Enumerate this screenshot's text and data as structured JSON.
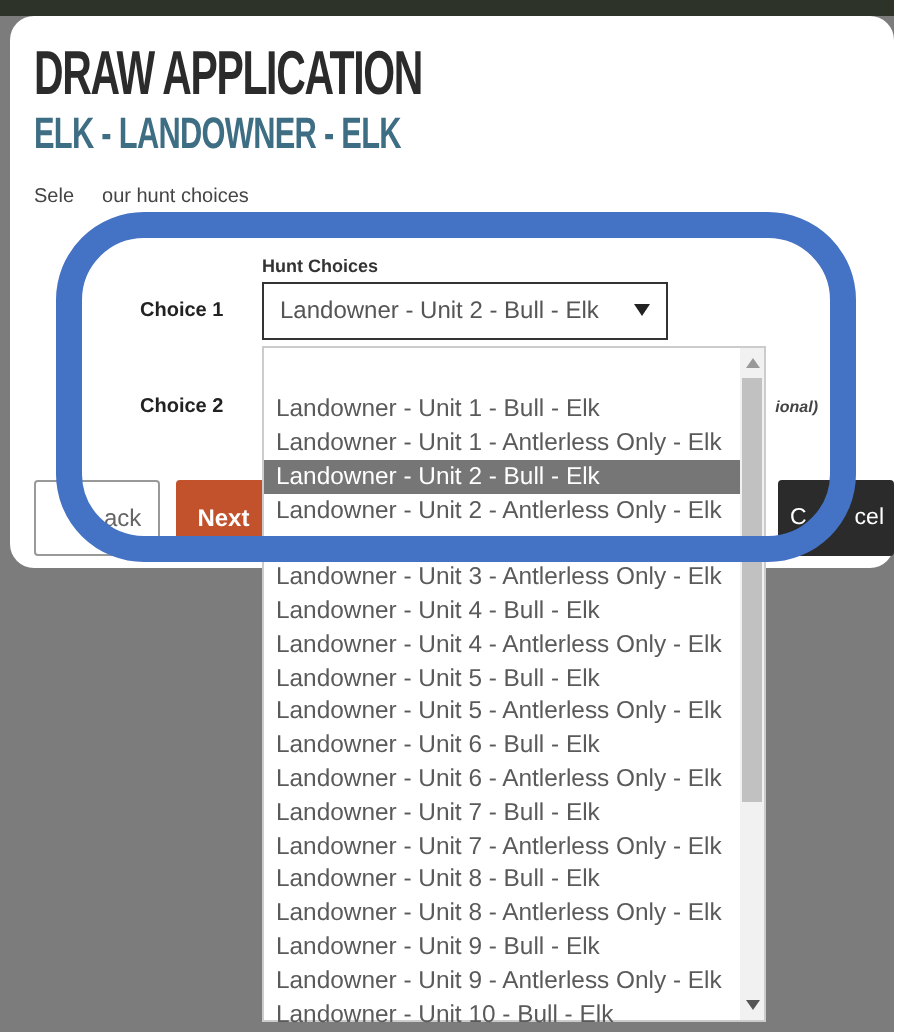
{
  "dialog": {
    "title": "DRAW APPLICATION",
    "subtitle": "ELK - LANDOWNER - ELK",
    "intro_parts": [
      "Sele",
      "our hunt choices"
    ],
    "field_label": "Hunt Choices",
    "choices": [
      {
        "label": "Choice 1",
        "value": "Landowner - Unit 2 - Bull - Elk"
      },
      {
        "label": "Choice 2",
        "note": "ional)"
      }
    ],
    "back_button": "ack",
    "next_button": "Next",
    "cancel_button_parts": [
      "C",
      "cel"
    ]
  },
  "dropdown": {
    "options": [
      {
        "kind": "blank"
      },
      {
        "kind": "option",
        "label": "Landowner - Unit 1 - Bull - Elk",
        "selected": false
      },
      {
        "kind": "option",
        "label": "Landowner - Unit 1 - Antlerless Only - Elk",
        "selected": false
      },
      {
        "kind": "option",
        "label": "Landowner - Unit 2 - Bull - Elk",
        "selected": true
      },
      {
        "kind": "option",
        "label": "Landowner - Unit 2 - Antlerless Only - Elk",
        "selected": false
      },
      {
        "kind": "blank"
      },
      {
        "kind": "option",
        "label": "Landowner - Unit 3 - Antlerless Only - Elk",
        "selected": false
      },
      {
        "kind": "option",
        "label": "Landowner - Unit 4 - Bull - Elk",
        "selected": false
      },
      {
        "kind": "option",
        "label": "Landowner - Unit 4 - Antlerless Only - Elk",
        "selected": false
      },
      {
        "kind": "option",
        "label": "Landowner - Unit 5 - Bull - Elk",
        "selected": false
      },
      {
        "kind": "option",
        "label": "Landowner - Unit 5 - Antlerless Only - Elk",
        "selected": false
      },
      {
        "kind": "option",
        "label": "Landowner - Unit 6 - Bull - Elk",
        "selected": false
      },
      {
        "kind": "option",
        "label": "Landowner - Unit 6 - Antlerless Only - Elk",
        "selected": false
      },
      {
        "kind": "option",
        "label": "Landowner - Unit 7 - Bull - Elk",
        "selected": false
      },
      {
        "kind": "option",
        "label": "Landowner - Unit 7 - Antlerless Only - Elk",
        "selected": false
      },
      {
        "kind": "option",
        "label": "Landowner - Unit 8 - Bull - Elk",
        "selected": false
      },
      {
        "kind": "option",
        "label": "Landowner - Unit 8 - Antlerless Only - Elk",
        "selected": false
      },
      {
        "kind": "option",
        "label": "Landowner - Unit 9 - Bull - Elk",
        "selected": false
      },
      {
        "kind": "option",
        "label": "Landowner - Unit 9 - Antlerless Only - Elk",
        "selected": false
      },
      {
        "kind": "option",
        "label": "Landowner - Unit 10 - Bull - Elk",
        "selected": false
      }
    ]
  }
}
